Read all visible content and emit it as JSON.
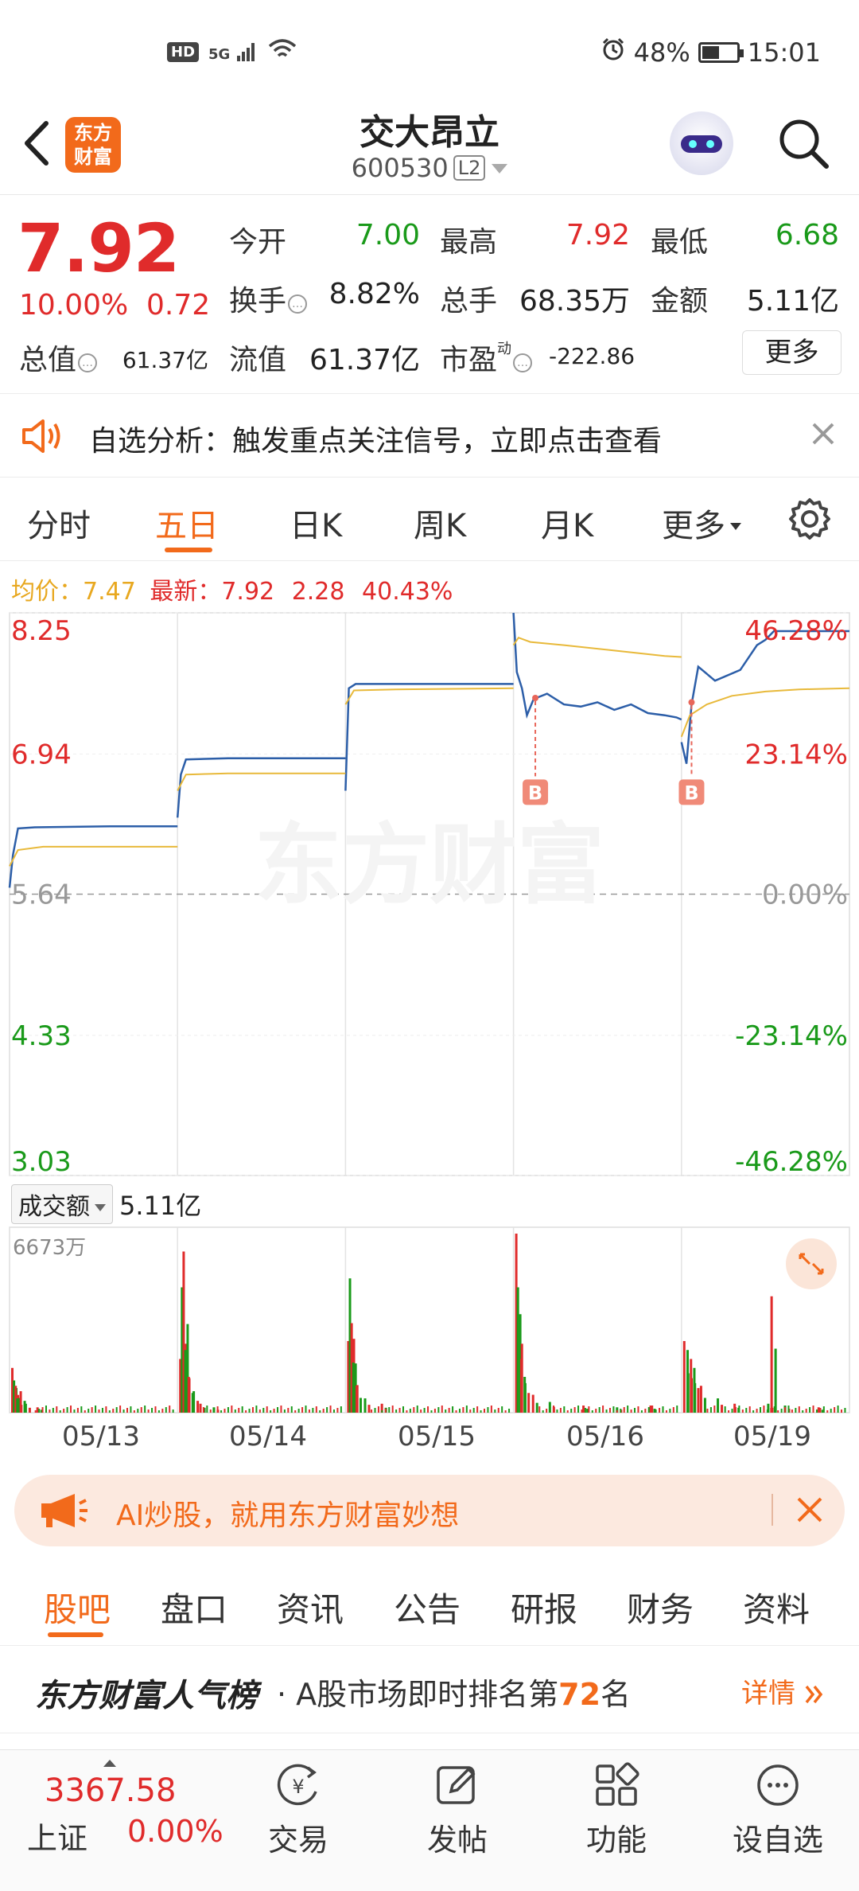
{
  "status_bar": {
    "left_icons": [
      "hd-icon",
      "signal-5g-icon",
      "wifi-icon"
    ],
    "hd": "HD",
    "net": "5G",
    "battery": "48%",
    "battery_level": 0.48,
    "time": "15:01"
  },
  "header": {
    "logo_line1": "东方",
    "logo_line2": "财富",
    "stock_name": "交大昂立",
    "stock_code": "600530",
    "level_badge": "L2"
  },
  "quote": {
    "price": "7.92",
    "change_pct": "10.00%",
    "change_abs": "0.72",
    "rows": [
      [
        {
          "label": "今开",
          "value": "7.00",
          "color": "#1a9a1a"
        },
        {
          "label": "最高",
          "value": "7.92",
          "color": "#e02b2b"
        },
        {
          "label": "最低",
          "value": "6.68",
          "color": "#1a9a1a"
        }
      ],
      [
        {
          "label": "换手",
          "value": "8.82%",
          "color": "#222222"
        },
        {
          "label": "总手",
          "value": "68.35万",
          "color": "#222222"
        },
        {
          "label": "金额",
          "value": "5.11亿",
          "color": "#222222"
        }
      ]
    ],
    "total_value_label": "总值",
    "total_value": "61.37亿",
    "float_value_label": "流值",
    "float_value": "61.37亿",
    "pe_label": "市盈",
    "pe_sup": "动",
    "pe_value": "-222.86",
    "more_label": "更多"
  },
  "alert": {
    "text": "自选分析：触发重点关注信号，立即点击查看"
  },
  "chart_tabs": {
    "items": [
      "分时",
      "五日",
      "日K",
      "周K",
      "月K",
      "更多"
    ],
    "active": "五日"
  },
  "legend": {
    "avg_label": "均价：",
    "avg_value": "7.47",
    "last_label": "最新：",
    "last_value": "7.92",
    "last_chg": "2.28",
    "last_pct": "40.43%"
  },
  "watermark": "东方财富",
  "volume": {
    "selector_label": "成交额",
    "total": "5.11亿",
    "max_label": "6673万"
  },
  "ad": {
    "text": "AI炒股，就用东方财富妙想"
  },
  "bottom_tabs": {
    "items": [
      "股吧",
      "盘口",
      "资讯",
      "公告",
      "研报",
      "财务",
      "资料"
    ],
    "active": "股吧"
  },
  "ranking": {
    "brand": "东方财富人气榜",
    "desc_prefix": "· A股市场即时排名第",
    "rank": "72",
    "desc_suffix": "名",
    "detail": "详情"
  },
  "footer": {
    "index_value": "3367.58",
    "index_name": "上证",
    "index_change": "0.00%",
    "items": [
      {
        "label": "交易",
        "icon": "yuan-refresh-icon"
      },
      {
        "label": "发帖",
        "icon": "edit-icon"
      },
      {
        "label": "功能",
        "icon": "grid-icon"
      },
      {
        "label": "设自选",
        "icon": "chat-dots-icon"
      }
    ]
  },
  "chart_data": {
    "type": "line",
    "title": "",
    "x_labels": [
      "05/13",
      "05/14",
      "05/15",
      "05/16",
      "05/19"
    ],
    "y_ticks_left": [
      "8.25",
      "6.94",
      "5.64",
      "4.33",
      "3.03"
    ],
    "y_ticks_right": [
      "46.28%",
      "23.14%",
      "0.00%",
      "-23.14%",
      "-46.28%"
    ],
    "ylim": [
      3.03,
      8.25
    ],
    "prev_close": 5.64,
    "series": [
      {
        "name": "最新",
        "color": "#2c5ea8",
        "days": [
          [
            [
              0,
              5.7
            ],
            [
              0.02,
              6.0
            ],
            [
              0.05,
              6.25
            ],
            [
              0.15,
              6.26
            ],
            [
              0.6,
              6.27
            ],
            [
              1,
              6.27
            ]
          ],
          [
            [
              0,
              6.35
            ],
            [
              0.02,
              6.75
            ],
            [
              0.05,
              6.89
            ],
            [
              0.3,
              6.9
            ],
            [
              1,
              6.9
            ]
          ],
          [
            [
              0,
              6.6
            ],
            [
              0.02,
              7.55
            ],
            [
              0.06,
              7.59
            ],
            [
              1,
              7.59
            ]
          ],
          [
            [
              0,
              8.25
            ],
            [
              0.02,
              7.7
            ],
            [
              0.05,
              7.55
            ],
            [
              0.08,
              7.3
            ],
            [
              0.12,
              7.45
            ],
            [
              0.2,
              7.5
            ],
            [
              0.3,
              7.4
            ],
            [
              0.4,
              7.38
            ],
            [
              0.5,
              7.42
            ],
            [
              0.6,
              7.35
            ],
            [
              0.7,
              7.4
            ],
            [
              0.8,
              7.32
            ],
            [
              0.9,
              7.3
            ],
            [
              0.97,
              7.28
            ],
            [
              1,
              7.26
            ]
          ],
          [
            [
              0,
              7.05
            ],
            [
              0.03,
              6.85
            ],
            [
              0.06,
              7.4
            ],
            [
              0.1,
              7.75
            ],
            [
              0.2,
              7.62
            ],
            [
              0.35,
              7.72
            ],
            [
              0.45,
              7.95
            ],
            [
              0.5,
              8.0
            ],
            [
              0.55,
              8.08
            ],
            [
              0.7,
              8.08
            ],
            [
              0.85,
              8.08
            ],
            [
              1,
              8.08
            ]
          ]
        ]
      },
      {
        "name": "均价",
        "color": "#e8b93a",
        "days": [
          [
            [
              0,
              5.9
            ],
            [
              0.05,
              6.05
            ],
            [
              0.2,
              6.08
            ],
            [
              1,
              6.08
            ]
          ],
          [
            [
              0,
              6.6
            ],
            [
              0.05,
              6.75
            ],
            [
              0.3,
              6.76
            ],
            [
              1,
              6.76
            ]
          ],
          [
            [
              0,
              7.4
            ],
            [
              0.05,
              7.53
            ],
            [
              0.3,
              7.54
            ],
            [
              1,
              7.55
            ]
          ],
          [
            [
              0,
              7.95
            ],
            [
              0.03,
              8.02
            ],
            [
              0.1,
              7.98
            ],
            [
              0.3,
              7.95
            ],
            [
              0.6,
              7.9
            ],
            [
              0.9,
              7.85
            ],
            [
              1,
              7.84
            ]
          ],
          [
            [
              0,
              7.1
            ],
            [
              0.05,
              7.3
            ],
            [
              0.15,
              7.4
            ],
            [
              0.3,
              7.48
            ],
            [
              0.5,
              7.52
            ],
            [
              0.7,
              7.54
            ],
            [
              1,
              7.55
            ]
          ]
        ]
      }
    ],
    "buy_markers": [
      {
        "day": 3,
        "pos": 0.13,
        "price": 7.46,
        "label": "B"
      },
      {
        "day": 4,
        "pos": 0.06,
        "price": 7.42,
        "label": "B"
      }
    ],
    "volume": {
      "max": 6673,
      "unit": "万",
      "spikes": [
        [
          [
            0,
            0.25
          ],
          [
            0.01,
            0.18
          ],
          [
            0.02,
            0.15
          ],
          [
            0.03,
            0.08
          ],
          [
            0.05,
            0.12
          ],
          [
            0.08,
            0.05
          ],
          [
            0.15,
            0.03
          ]
        ],
        [
          [
            0,
            0.3
          ],
          [
            0.01,
            0.7
          ],
          [
            0.02,
            0.9
          ],
          [
            0.03,
            0.35
          ],
          [
            0.05,
            0.2
          ],
          [
            0.08,
            0.12
          ],
          [
            0.12,
            0.05
          ],
          [
            0.2,
            0.03
          ]
        ],
        [
          [
            0,
            0.4
          ],
          [
            0.01,
            0.75
          ],
          [
            0.02,
            0.5
          ],
          [
            0.03,
            0.28
          ],
          [
            0.05,
            0.15
          ],
          [
            0.1,
            0.08
          ],
          [
            0.2,
            0.05
          ]
        ],
        [
          [
            0,
            1.0
          ],
          [
            0.01,
            0.7
          ],
          [
            0.03,
            0.3
          ],
          [
            0.05,
            0.2
          ],
          [
            0.1,
            0.1
          ],
          [
            0.2,
            0.06
          ],
          [
            0.4,
            0.04
          ],
          [
            0.6,
            0.03
          ],
          [
            0.8,
            0.04
          ]
        ],
        [
          [
            0,
            0.4
          ],
          [
            0.02,
            0.35
          ],
          [
            0.04,
            0.3
          ],
          [
            0.06,
            0.25
          ],
          [
            0.1,
            0.15
          ],
          [
            0.2,
            0.08
          ],
          [
            0.3,
            0.05
          ],
          [
            0.5,
            0.05
          ],
          [
            0.52,
            0.65
          ],
          [
            0.6,
            0.04
          ],
          [
            0.8,
            0.03
          ]
        ]
      ]
    }
  }
}
